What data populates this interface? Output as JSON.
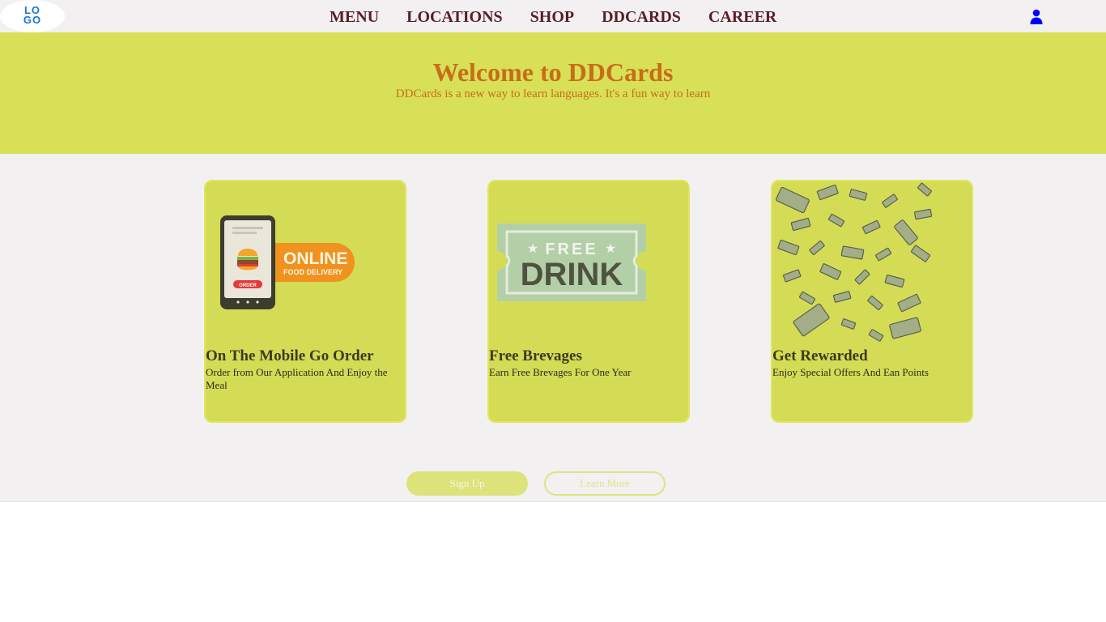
{
  "header": {
    "logo_text": "LOGO",
    "nav": [
      "MENU",
      "LOCATIONS",
      "SHOP",
      "DDCARDS",
      "CAREER"
    ],
    "user_icon": "user-icon"
  },
  "hero": {
    "title": "Welcome to DDCards",
    "subtitle": "DDCards is a new way to learn languages. It's a fun way to learn"
  },
  "cards": [
    {
      "title": "On The Mobile Go Order",
      "description": "Order from Our Application And Enjoy the Meal",
      "image": {
        "icon": "mobile-order-icon",
        "big_word": "ONLINE",
        "small_word": "FOOD DELIVERY",
        "button_word": "ORDER"
      }
    },
    {
      "title": "Free Brevages",
      "description": "Earn Free Brevages For One Year",
      "image": {
        "icon": "free-drink-ticket-icon",
        "top_word": "FREE",
        "big_word": "DRINK"
      }
    },
    {
      "title": "Get Rewarded",
      "description": "Enjoy Special Offers And Ean Points",
      "image": {
        "icon": "falling-money-icon"
      }
    }
  ],
  "buttons": {
    "signup": "Sign Up",
    "learn_more": "Learn More"
  },
  "colors": {
    "header_bg": "#f2f0f1",
    "hero_bg": "#d8e058",
    "hero_text": "#c86d17",
    "nav_text": "#5a1d27",
    "card_bg": "#d4dc56",
    "logo_blue": "#1976d2",
    "user_icon_blue": "#0000ff"
  }
}
